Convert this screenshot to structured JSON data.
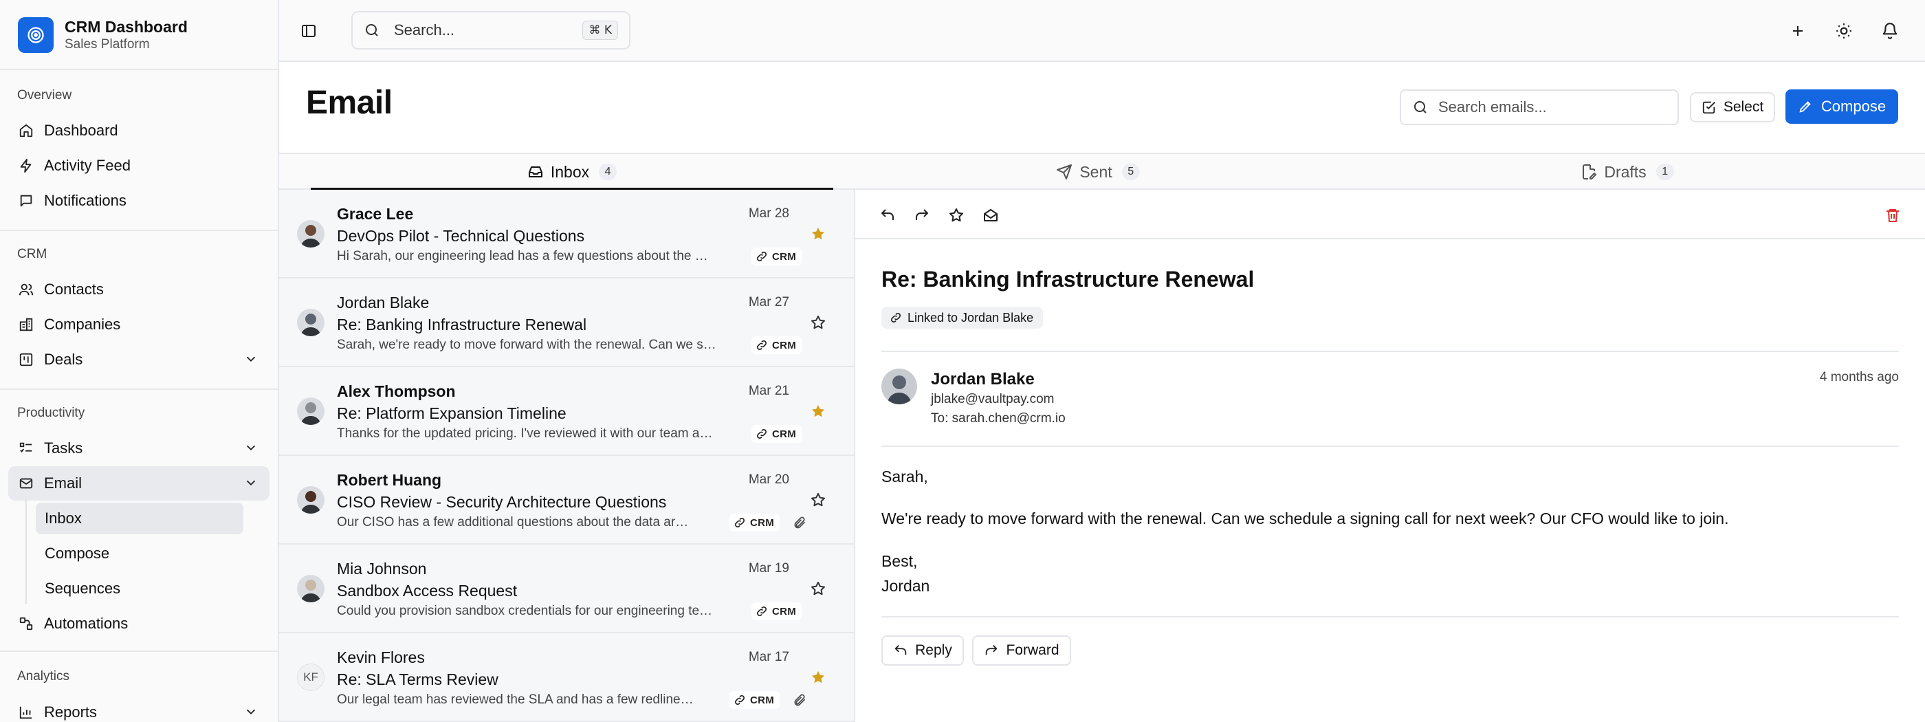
{
  "brand": {
    "title": "CRM Dashboard",
    "subtitle": "Sales Platform",
    "color": "#1467e0"
  },
  "sidebar": {
    "sections": {
      "overview": "Overview",
      "crm": "CRM",
      "productivity": "Productivity",
      "analytics": "Analytics"
    },
    "items": {
      "dashboard": {
        "label": "Dashboard",
        "icon": "home-icon"
      },
      "activity": {
        "label": "Activity Feed",
        "icon": "bolt-icon"
      },
      "notifications": {
        "label": "Notifications",
        "icon": "message-icon"
      },
      "contacts": {
        "label": "Contacts",
        "icon": "users-icon"
      },
      "companies": {
        "label": "Companies",
        "icon": "building-icon"
      },
      "deals": {
        "label": "Deals",
        "icon": "kanban-icon"
      },
      "tasks": {
        "label": "Tasks",
        "icon": "list-todo-icon"
      },
      "email": {
        "label": "Email",
        "icon": "mail-icon"
      },
      "automations": {
        "label": "Automations",
        "icon": "workflow-icon"
      },
      "reports": {
        "label": "Reports",
        "icon": "bar-chart-icon"
      }
    },
    "email_sub": {
      "inbox": "Inbox",
      "compose": "Compose",
      "sequences": "Sequences"
    }
  },
  "topbar": {
    "search_placeholder": "Search...",
    "shortcut": "⌘ K"
  },
  "header": {
    "title": "Email",
    "search_placeholder": "Search emails...",
    "select_label": "Select",
    "compose_label": "Compose"
  },
  "tabs": {
    "inbox": {
      "label": "Inbox",
      "count": "4"
    },
    "sent": {
      "label": "Sent",
      "count": "5"
    },
    "drafts": {
      "label": "Drafts",
      "count": "1"
    }
  },
  "emails": [
    {
      "name": "Grace Lee",
      "date": "Mar 28",
      "subject": "DevOps Pilot - Technical Questions",
      "preview": "Hi Sarah, our engineering lead has a few questions about the CI/C...",
      "badge": "CRM",
      "starred": true,
      "unread": true,
      "attachment": false,
      "avatar_color": "#6b4a36"
    },
    {
      "name": "Jordan Blake",
      "date": "Mar 27",
      "subject": "Re: Banking Infrastructure Renewal",
      "preview": "Sarah, we're ready to move forward with the renewal. Can we sch...",
      "badge": "CRM",
      "starred": false,
      "unread": false,
      "attachment": false,
      "avatar_color": "#5b6470"
    },
    {
      "name": "Alex Thompson",
      "date": "Mar 21",
      "subject": "Re: Platform Expansion Timeline",
      "preview": "Thanks for the updated pricing. I've reviewed it with our team and ...",
      "badge": "CRM",
      "starred": true,
      "unread": true,
      "attachment": false,
      "avatar_color": "#8a8f96"
    },
    {
      "name": "Robert Huang",
      "date": "Mar 20",
      "subject": "CISO Review - Security Architecture Questions",
      "preview": "Our CISO has a few additional questions about the data archit...",
      "badge": "CRM",
      "starred": false,
      "unread": true,
      "attachment": true,
      "avatar_color": "#4a2f22"
    },
    {
      "name": "Mia Johnson",
      "date": "Mar 19",
      "subject": "Sandbox Access Request",
      "preview": "Could you provision sandbox credentials for our engineering team...",
      "badge": "CRM",
      "starred": false,
      "unread": false,
      "attachment": false,
      "avatar_color": "#c9b8a8"
    },
    {
      "name": "Kevin Flores",
      "date": "Mar 17",
      "subject": "Re: SLA Terms Review",
      "preview": "Our legal team has reviewed the SLA and has a few redline ite...",
      "badge": "CRM",
      "starred": true,
      "unread": false,
      "attachment": true,
      "initials": "KF"
    }
  ],
  "message": {
    "subject": "Re: Banking Infrastructure Renewal",
    "linked": "Linked to Jordan Blake",
    "from_name": "Jordan Blake",
    "from_email": "jblake@vaultpay.com",
    "to": "To: sarah.chen@crm.io",
    "time": "4 months ago",
    "greeting": "Sarah,",
    "body": "We're ready to move forward with the renewal. Can we schedule a signing call for next week? Our CFO would like to join.",
    "signoff": "Best,",
    "signature": "Jordan",
    "reply_label": "Reply",
    "forward_label": "Forward"
  },
  "colors": {
    "accent": "#1467e0",
    "star": "#d4a017",
    "danger": "#e0312f"
  }
}
